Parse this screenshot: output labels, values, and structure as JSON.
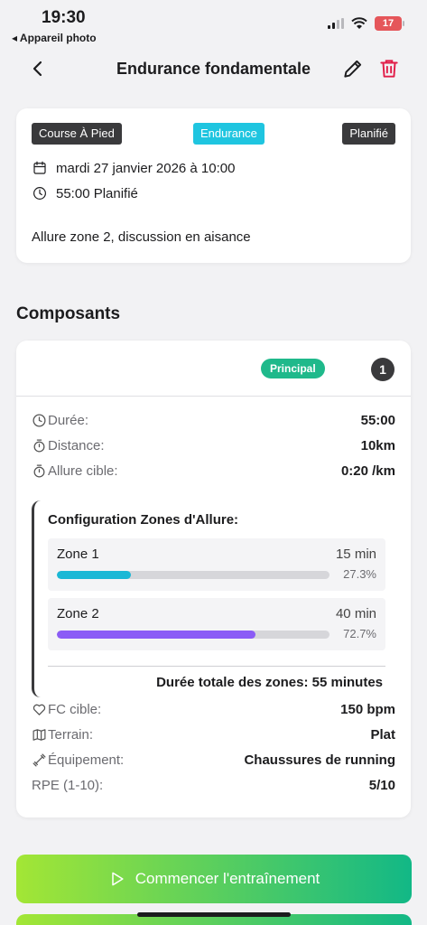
{
  "status_bar": {
    "time": "19:30",
    "back_app": "◂ Appareil photo",
    "battery": "17"
  },
  "nav": {
    "title": "Endurance fondamentale"
  },
  "session": {
    "sport_tag": "Course À Pied",
    "category_tag": "Endurance",
    "status_tag": "Planifié",
    "date": "mardi 27 janvier 2026 à 10:00",
    "duration": "55:00 Planifié",
    "description": "Allure zone 2, discussion en aisance"
  },
  "components": {
    "section_title": "Composants",
    "badge_principal": "Principal",
    "badge_number": "1",
    "duree_label": "Durée:",
    "duree_value": "55:00",
    "distance_label": "Distance:",
    "distance_value": "10km",
    "allure_label": "Allure cible:",
    "allure_value": "0:20 /km",
    "zones_title": "Configuration Zones d'Allure:",
    "zones": [
      {
        "name": "Zone 1",
        "duration": "15 min",
        "percent": "27.3%",
        "fraction": 0.273,
        "color": "#1ab8d6"
      },
      {
        "name": "Zone 2",
        "duration": "40 min",
        "percent": "72.7%",
        "fraction": 0.727,
        "color": "#8b5cf6"
      }
    ],
    "zones_total": "Durée totale des zones: 55 minutes",
    "fc_label": "FC cible:",
    "fc_value": "150 bpm",
    "terrain_label": "Terrain:",
    "terrain_value": "Plat",
    "equipement_label": "Équipement:",
    "equipement_value": "Chaussures de running",
    "rpe_label": "RPE (1-10):",
    "rpe_value": "5/10"
  },
  "actions": {
    "start_label": "Commencer l'entraînement"
  },
  "colors": {
    "accent_cyan": "#1fc5e0",
    "accent_green": "#1fb98b",
    "delete_red": "#e11d48"
  }
}
